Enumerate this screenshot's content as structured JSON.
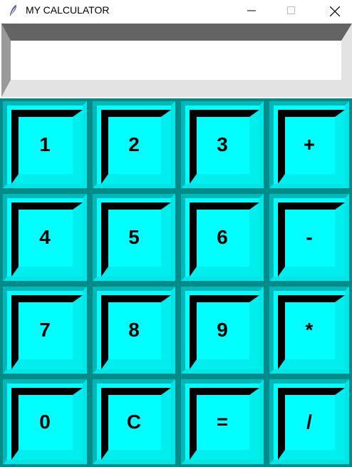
{
  "window": {
    "title": "MY CALCULATOR",
    "icon": "feather-icon",
    "controls": [
      "minimize-icon",
      "maximize-icon",
      "close-icon"
    ]
  },
  "display": {
    "value": ""
  },
  "keys": [
    "1",
    "2",
    "3",
    "+",
    "4",
    "5",
    "6",
    "-",
    "7",
    "8",
    "9",
    "*",
    "0",
    "C",
    "=",
    "/"
  ],
  "colors": {
    "keypad_background": "#008b8b",
    "key_face": "#00ffff",
    "key_shadow": "#000000",
    "display_border_dark": "#646464",
    "display_border_light": "#e3e3e3"
  }
}
